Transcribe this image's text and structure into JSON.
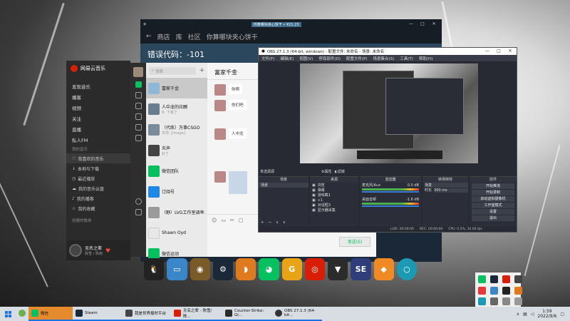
{
  "steam": {
    "nav_back": "←",
    "nav_items": [
      "商店",
      "库",
      "社区",
      "你算哪块夹心饼干"
    ],
    "error_text": "错误代码：-101",
    "user_badge": "你算哪块夹心饼干 • ¥21.23"
  },
  "netease": {
    "app_name": "网易云音乐",
    "menu": [
      "发现音乐",
      "播客",
      "视频",
      "关注",
      "直播",
      "私人FM"
    ],
    "section_mine": "我的音乐",
    "playlists": [
      "我喜欢的音乐",
      "本地与下载",
      "最近播放",
      "我的音乐云盘",
      "我的播客",
      "我的收藏"
    ],
    "section_created": "创建的歌单",
    "now_playing_title": "无名之辈",
    "now_playing_artist": "陈雪 / 陈雨"
  },
  "wechat": {
    "search_placeholder": "搜索",
    "add": "+",
    "chats": [
      {
        "name": "富家千金",
        "preview": "",
        "time": "",
        "color": "#8fb8d8"
      },
      {
        "name": "人中龙的应酬",
        "preview": "B: 下滑了",
        "time": "",
        "color": "#6a7d8e"
      },
      {
        "name": "（代练）万事CSGO",
        "preview": "苏苏: [Image]",
        "time": "",
        "color": "#7a8b9a"
      },
      {
        "name": "炎声",
        "preview": "好了",
        "time": "",
        "color": "#444"
      },
      {
        "name": "微信团队",
        "preview": "",
        "time": "",
        "color": "#07c160"
      },
      {
        "name": "订阅号",
        "preview": "",
        "time": "",
        "color": "#1e88e5"
      },
      {
        "name": "（野）LVG工作室调率...",
        "preview": "",
        "time": "",
        "color": "#9b9b9b"
      },
      {
        "name": "Shawn Oyd",
        "preview": "",
        "time": "",
        "color": "#e7e7e7"
      },
      {
        "name": "微信运动",
        "preview": "",
        "time": "",
        "color": "#07c160"
      }
    ],
    "convo_title": "富家千金",
    "messages": [
      "你啊",
      "你们吧",
      "人中龙"
    ],
    "send_label": "发送(S)"
  },
  "obs": {
    "title": "OBS 27.1.3 (64-bit, windows) - 配置文件: 未命名 - 场景: 未命名",
    "menu": [
      "文件(F)",
      "编辑(E)",
      "视图(V)",
      "停靠部件(D)",
      "配置文件(P)",
      "场景集合(S)",
      "工具(T)",
      "帮助(H)"
    ],
    "no_source": "未选源源",
    "prop_btn": "属性",
    "filter_btn": "滤镜",
    "scenes_header": "场景",
    "scene_item": "场景",
    "sources_header": "来源",
    "sources": [
      "浏览",
      "弹幕",
      "游戏截1",
      "+1",
      "对话框3",
      "显示器采集"
    ],
    "mixer_header": "混音器",
    "mixer": [
      {
        "name": "麦克风/Aux",
        "db": "0.0 dB"
      },
      {
        "name": "桌面音频",
        "db": "-1.6 dB"
      }
    ],
    "transition_header": "转场特效",
    "transition_type": "渐变",
    "duration_label": "时长",
    "duration_value": "300 ms",
    "controls_header": "控件",
    "controls": [
      "开始推流",
      "开始录制",
      "启动虚拟摄像机",
      "工作室模式",
      "设置",
      "退出"
    ],
    "status": [
      "LIVE: 00:00:00",
      "REC: 00:00:00",
      "CPU: 0.5%, 30.00 fps"
    ]
  },
  "taskbar": {
    "items": [
      "微信",
      "Steam",
      "我是世界报时平台",
      "无名之辈 - 陈雪/陈...",
      "Counter-Strike: Gl...",
      "OBS 27.1.3 (64-bit..."
    ],
    "time": "1:59",
    "date": "2022/9/6"
  },
  "dock_apps": [
    {
      "icon": "qq-icon",
      "color": "#222"
    },
    {
      "icon": "computer-icon",
      "color": "#3a86c8"
    },
    {
      "icon": "owl-icon",
      "color": "#7b5a2a"
    },
    {
      "icon": "steam-icon",
      "color": "#1b2838"
    },
    {
      "icon": "duck-icon",
      "color": "#e07a1f"
    },
    {
      "icon": "wechat-icon",
      "color": "#07c160"
    },
    {
      "icon": "game-icon",
      "color": "#e8a317"
    },
    {
      "icon": "netease-icon",
      "color": "#d81e06"
    },
    {
      "icon": "csgo-icon",
      "color": "#2b2b2b"
    },
    {
      "icon": "se-icon",
      "color": "#2f3e7a"
    },
    {
      "icon": "doudizhu-icon",
      "color": "#f08a24"
    },
    {
      "icon": "ring-icon",
      "color": "#1a9bb3"
    }
  ]
}
